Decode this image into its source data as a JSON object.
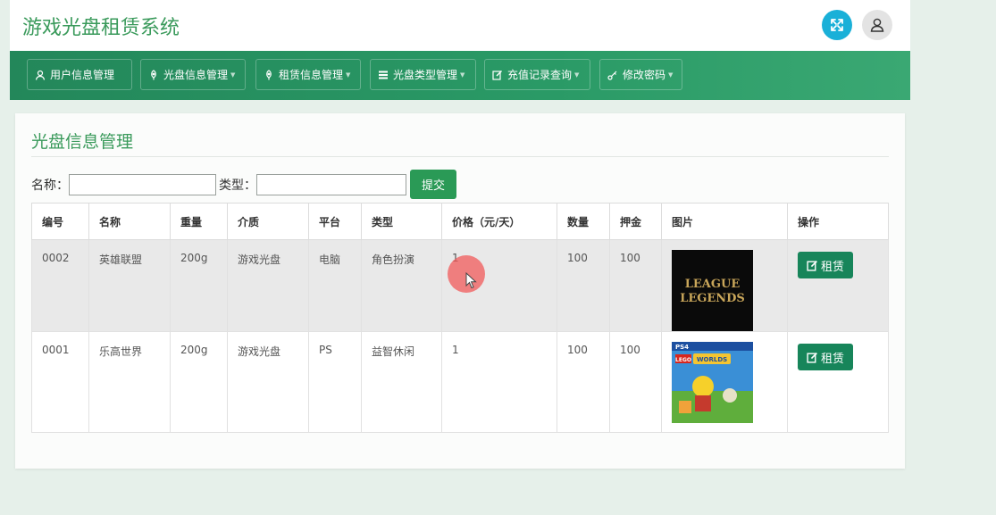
{
  "app": {
    "title": "游戏光盘租赁系统"
  },
  "header": {
    "fullscreen_icon": "expand-icon",
    "user_icon": "user-icon"
  },
  "nav": {
    "items": [
      {
        "label": "用户信息管理",
        "icon": "user-icon",
        "has_caret": false
      },
      {
        "label": "光盘信息管理",
        "icon": "leaf-icon",
        "has_caret": true
      },
      {
        "label": "租赁信息管理",
        "icon": "leaf-icon",
        "has_caret": true
      },
      {
        "label": "光盘类型管理",
        "icon": "list-icon",
        "has_caret": true
      },
      {
        "label": "充值记录查询",
        "icon": "edit-icon",
        "has_caret": true
      },
      {
        "label": "修改密码",
        "icon": "key-icon",
        "has_caret": true
      }
    ]
  },
  "panel": {
    "title": "光盘信息管理"
  },
  "search": {
    "name_label": "名称：",
    "name_value": "",
    "type_label": "类型：",
    "type_value": "",
    "submit_label": "提交"
  },
  "table": {
    "headers": [
      "编号",
      "名称",
      "重量",
      "介质",
      "平台",
      "类型",
      "价格（元/天）",
      "数量",
      "押金",
      "图片",
      "操作"
    ],
    "rows": [
      {
        "id": "0002",
        "name": "英雄联盟",
        "weight": "200g",
        "medium": "游戏光盘",
        "platform": "电脑",
        "type": "角色扮演",
        "price": "1",
        "quantity": "100",
        "deposit": "100",
        "cover_text": "LEAGUE LEGENDS",
        "action": "租赁"
      },
      {
        "id": "0001",
        "name": "乐高世界",
        "weight": "200g",
        "medium": "游戏光盘",
        "platform": "PS",
        "type": "益智休闲",
        "price": "1",
        "quantity": "100",
        "deposit": "100",
        "cover_text": "PS4 LEGO WORLDS",
        "action": "租赁"
      }
    ]
  },
  "colors": {
    "accent": "#3a9a5b",
    "nav": "#23875a",
    "button": "#17855a",
    "fullscreen": "#1ab0d8"
  }
}
